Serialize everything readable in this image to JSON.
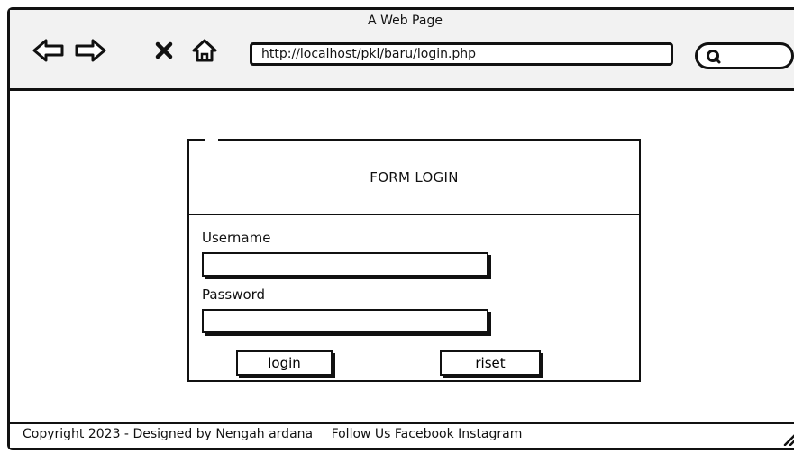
{
  "window": {
    "title": "A Web Page"
  },
  "toolbar": {
    "back_icon": "left-arrow-icon",
    "forward_icon": "right-arrow-icon",
    "stop_icon": "close-icon",
    "home_icon": "home-icon",
    "url": "http://localhost/pkl/baru/login.php",
    "search_icon": "search-icon"
  },
  "form": {
    "title": "FORM LOGIN",
    "username_label": "Username",
    "username_value": "",
    "password_label": "Password",
    "password_value": "",
    "login_label": "login",
    "reset_label": "riset"
  },
  "footer": {
    "copyright": "Copyright  2023 - Designed by Nengah ardana",
    "follow": "Follow Us Facebook Instagram"
  }
}
